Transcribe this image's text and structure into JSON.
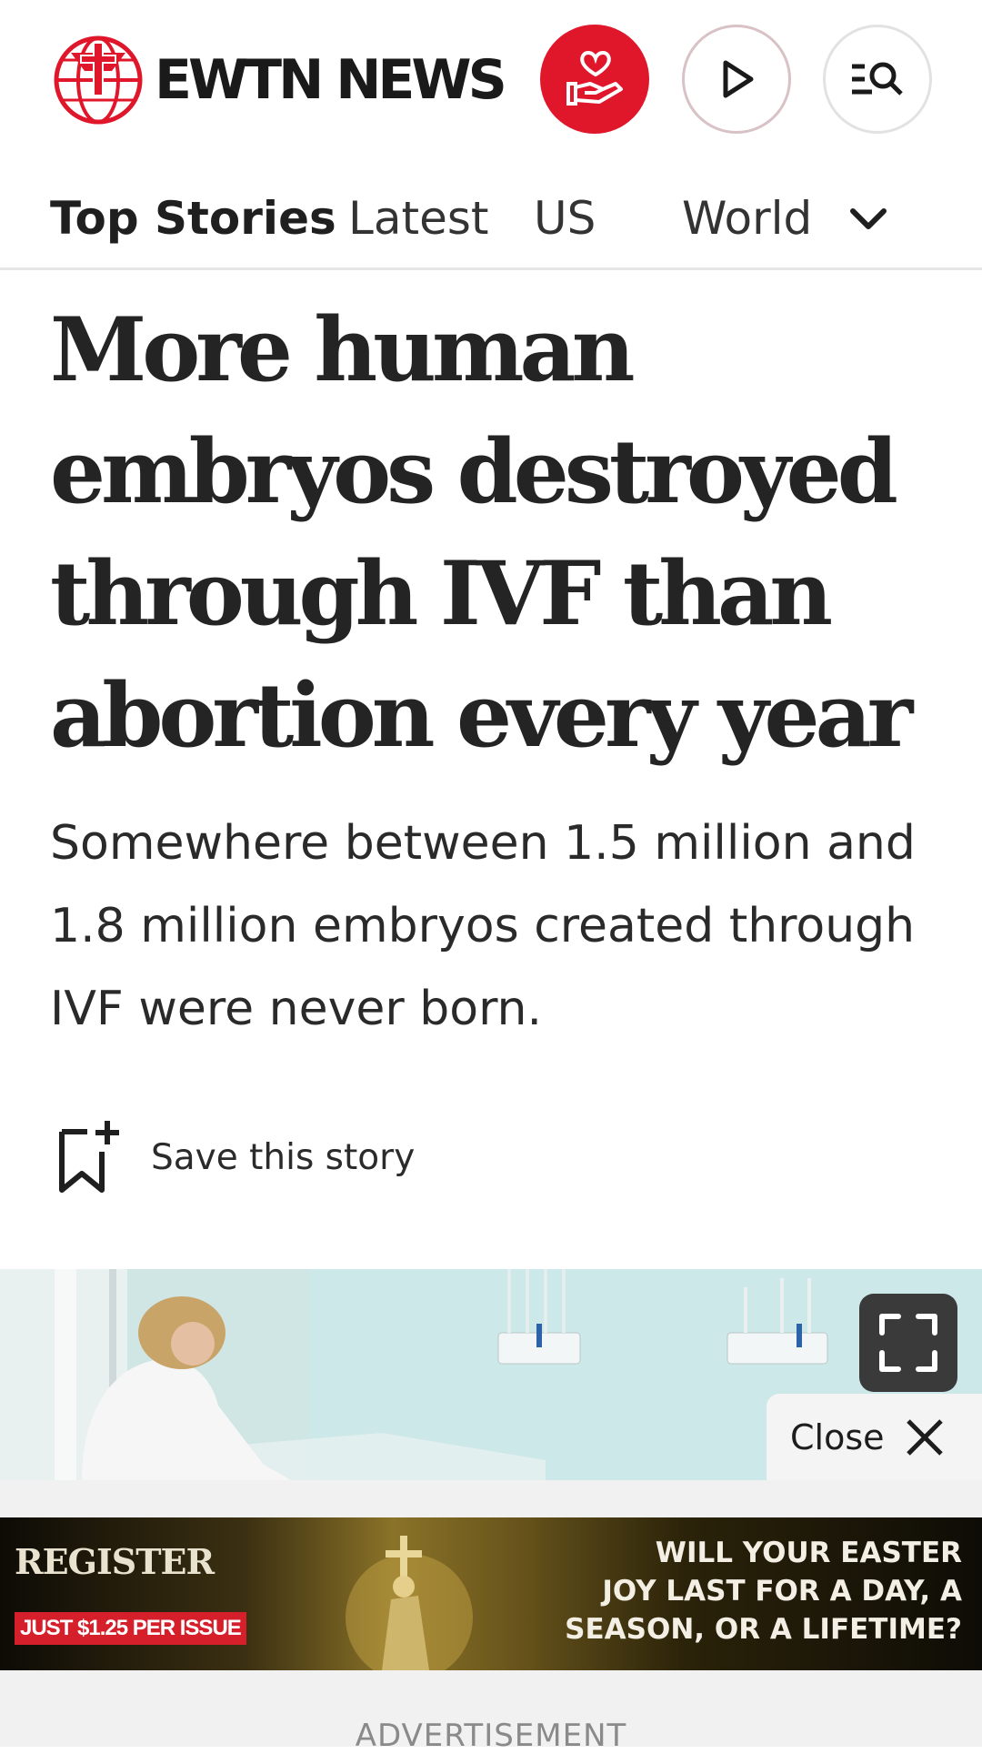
{
  "header": {
    "brand": "EWTN NEWS",
    "icons": {
      "logo": "globe-cross-logo",
      "donate": "heart-hand-icon",
      "play": "play-icon",
      "search": "menu-search-icon"
    },
    "colors": {
      "brand_red": "#e0162b"
    }
  },
  "nav": {
    "items": [
      {
        "label": "Top Stories",
        "active": true
      },
      {
        "label": "Latest"
      },
      {
        "label": "US"
      },
      {
        "label": "World"
      }
    ],
    "more_icon": "chevron-down-icon"
  },
  "article": {
    "headline": "More human embryos destroyed through IVF than abortion every year",
    "subhead": "Somewhere between 1.5 million and 1.8 million embryos created through IVF were never born.",
    "save_label": "Save this story"
  },
  "media": {
    "expand_icon": "fullscreen-icon",
    "close_label": "Close",
    "close_icon": "close-icon"
  },
  "ad": {
    "brand": "REGISTER",
    "price": "JUST $1.25 PER ISSUE",
    "copy_line1": "WILL YOUR EASTER",
    "copy_line2": "JOY LAST FOR A DAY, A",
    "copy_line3": "SEASON, OR A LIFETIME?",
    "label": "ADVERTISEMENT"
  }
}
